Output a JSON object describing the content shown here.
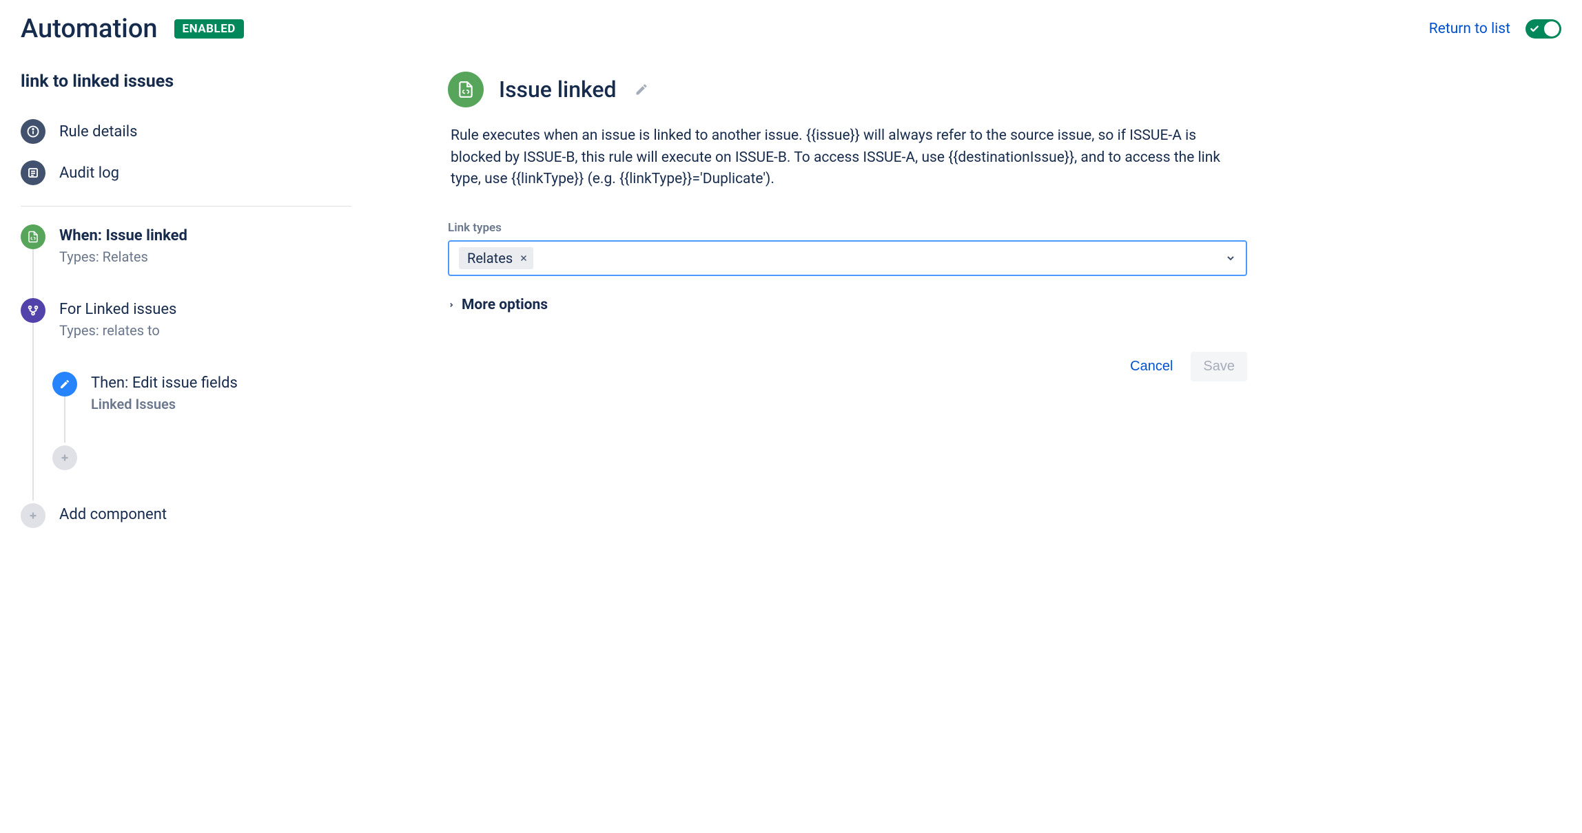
{
  "header": {
    "title": "Automation",
    "status_badge": "ENABLED",
    "return_link": "Return to list"
  },
  "sidebar": {
    "rule_name": "link to linked issues",
    "rule_details_label": "Rule details",
    "audit_log_label": "Audit log",
    "trigger": {
      "title": "When: Issue linked",
      "subtitle": "Types: Relates"
    },
    "branch": {
      "title": "For Linked issues",
      "subtitle": "Types: relates to"
    },
    "action": {
      "title": "Then: Edit issue fields",
      "subtitle": "Linked Issues"
    },
    "add_component_label": "Add component"
  },
  "main": {
    "title": "Issue linked",
    "description": "Rule executes when an issue is linked to another issue. {{issue}} will always refer to the source issue, so if ISSUE-A is blocked by ISSUE-B, this rule will execute on ISSUE-B. To access ISSUE-A, use {{destinationIssue}}, and to access the link type, use {{linkType}} (e.g. {{linkType}}='Duplicate').",
    "link_types_label": "Link types",
    "selected_tag": "Relates",
    "more_options_label": "More options",
    "cancel_label": "Cancel",
    "save_label": "Save"
  }
}
